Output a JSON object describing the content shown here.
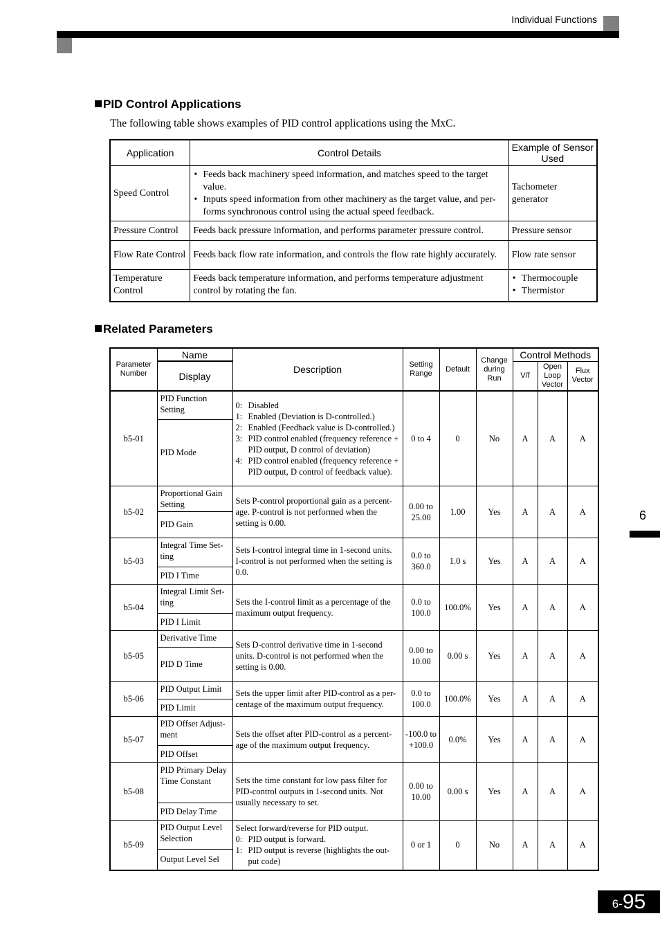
{
  "header": {
    "section_title": "Individual Functions"
  },
  "side_tab": {
    "chapter": "6"
  },
  "footer": {
    "page_prefix": "6-",
    "page_number": "95"
  },
  "pid_applications": {
    "heading": "PID Control Applications",
    "intro": "The following table shows examples of PID control applications using the MxC.",
    "columns": [
      "Application",
      "Control Details",
      "Example of Sensor Used"
    ],
    "rows": [
      {
        "application": "Speed Control",
        "details": [
          "Feeds back machinery speed information, and matches speed to the target value.",
          "Inputs speed information from other machinery as the target value, and per-forms synchronous control using the actual speed feedback."
        ],
        "sensor": "Tachometer generator"
      },
      {
        "application": "Pressure Control",
        "details_text": "Feeds back pressure information, and performs parameter pressure control.",
        "sensor": "Pressure sensor"
      },
      {
        "application": "Flow Rate Control",
        "details_text": "Feeds back flow rate information, and controls the flow rate highly accurately.",
        "sensor": "Flow rate sensor"
      },
      {
        "application": "Temperature Control",
        "details_text": "Feeds back temperature information, and performs temperature adjustment control by rotating the fan.",
        "sensors": [
          "Thermocouple",
          "Thermistor"
        ]
      }
    ]
  },
  "related_parameters": {
    "heading": "Related Parameters",
    "columns": {
      "param_number": "Parameter Number",
      "name": "Name",
      "display": "Display",
      "description": "Description",
      "setting_range": "Setting Range",
      "default": "Default",
      "change_during_run": "Change during Run",
      "control_methods": "Control Methods",
      "vf": "V/f",
      "olv": "Open Loop Vector",
      "flux": "Flux Vector"
    },
    "rows": [
      {
        "number": "b5-01",
        "name": "PID Function Setting",
        "display": "PID Mode",
        "options": [
          {
            "k": "0:",
            "t": "Disabled"
          },
          {
            "k": "1:",
            "t": "Enabled (Deviation is D-controlled.)"
          },
          {
            "k": "2:",
            "t": "Enabled (Feedback value is D-controlled.)"
          },
          {
            "k": "3:",
            "t": "PID control enabled (frequency reference + PID output, D control of deviation)"
          },
          {
            "k": "4:",
            "t": "PID control enabled (frequency reference + PID output, D control of feedback value)."
          }
        ],
        "range": "0 to 4",
        "default": "0",
        "change": "No",
        "vf": "A",
        "olv": "A",
        "flux": "A"
      },
      {
        "number": "b5-02",
        "name": "Proportional Gain Setting",
        "display": "PID Gain",
        "description": "Sets P-control proportional gain as a percent-age. P-control is not performed when the setting is 0.00.",
        "range": "0.00 to 25.00",
        "default": "1.00",
        "change": "Yes",
        "vf": "A",
        "olv": "A",
        "flux": "A"
      },
      {
        "number": "b5-03",
        "name": "Integral Time Set-ting",
        "display": "PID I Time",
        "description": "Sets I-control integral time in 1-second units. I-control is not performed when the setting is 0.0.",
        "range": "0.0 to 360.0",
        "default": "1.0 s",
        "change": "Yes",
        "vf": "A",
        "olv": "A",
        "flux": "A"
      },
      {
        "number": "b5-04",
        "name": "Integral Limit Set-ting",
        "display": "PID I Limit",
        "description": "Sets the I-control limit as a percentage of the maximum output frequency.",
        "range": "0.0 to 100.0",
        "default": "100.0%",
        "change": "Yes",
        "vf": "A",
        "olv": "A",
        "flux": "A"
      },
      {
        "number": "b5-05",
        "name": "Derivative Time",
        "display": "PID D Time",
        "description": "Sets D-control derivative time in 1-second units. D-control is not performed when the setting is 0.00.",
        "range": "0.00 to 10.00",
        "default": "0.00 s",
        "change": "Yes",
        "vf": "A",
        "olv": "A",
        "flux": "A"
      },
      {
        "number": "b5-06",
        "name": "PID Output Limit",
        "display": "PID Limit",
        "description": "Sets the upper limit after PID-control as a per-centage of the maximum output frequency.",
        "range": "0.0 to 100.0",
        "default": "100.0%",
        "change": "Yes",
        "vf": "A",
        "olv": "A",
        "flux": "A"
      },
      {
        "number": "b5-07",
        "name": "PID Offset Adjust-ment",
        "display": "PID Offset",
        "description": "Sets the offset after PID-control as a percent-age of the maximum output frequency.",
        "range": "-100.0 to +100.0",
        "default": "0.0%",
        "change": "Yes",
        "vf": "A",
        "olv": "A",
        "flux": "A"
      },
      {
        "number": "b5-08",
        "name": "PID Primary Delay Time Constant",
        "display": "PID Delay Time",
        "description": "Sets the time constant for low pass filter for PID-control outputs in 1-second units. Not usually necessary to set.",
        "range": "0.00 to 10.00",
        "default": "0.00 s",
        "change": "Yes",
        "vf": "A",
        "olv": "A",
        "flux": "A"
      },
      {
        "number": "b5-09",
        "name": "PID Output Level Selection",
        "display": "Output Level Sel",
        "description_intro": "Select forward/reverse for PID output.",
        "options": [
          {
            "k": "0:",
            "t": "PID output is forward."
          },
          {
            "k": "1:",
            "t": "PID output is reverse (highlights the out-put code)"
          }
        ],
        "range": "0 or 1",
        "default": "0",
        "change": "No",
        "vf": "A",
        "olv": "A",
        "flux": "A"
      }
    ]
  }
}
